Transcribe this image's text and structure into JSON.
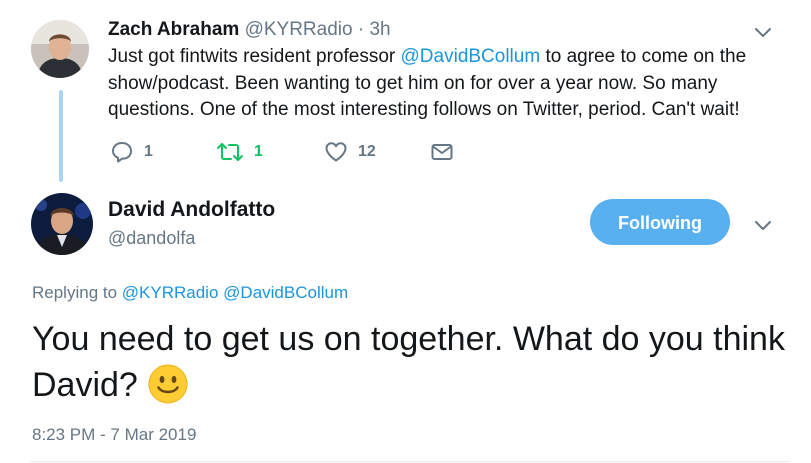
{
  "parent_tweet": {
    "display_name": "Zach Abraham",
    "handle": "@KYRRadio",
    "time": " · 3h",
    "text_before": "Just got fintwits resident professor ",
    "mention": "@DavidBCollum",
    "text_after": " to agree to come on the show/podcast. Been wanting to get him on for over a year now. So many questions. One of the most interesting follows on Twitter, period. Can't wait!",
    "actions": {
      "reply_count": "1",
      "retweet_count": "1",
      "like_count": "12"
    }
  },
  "main_tweet": {
    "display_name": "David Andolfatto",
    "handle": "@dandolfa",
    "follow_label": "Following",
    "replying_prefix": "Replying to ",
    "replying_mention_1": "@KYRRadio",
    "replying_mention_2": "@DavidBCollum",
    "text": "You need to get us on together. What do you think David?",
    "emoji": "slightly-smiling-face-emoji",
    "timestamp": "8:23 PM - 7 Mar 2019"
  },
  "colors": {
    "accent": "#1b95e0",
    "follow_button": "#58b0ee",
    "retweet_green": "#17bf63",
    "secondary_text": "#657786",
    "thread_line": "#a8d4f4"
  },
  "icons": [
    "reply-icon",
    "retweet-icon",
    "like-icon",
    "direct-message-icon",
    "chevron-down-icon"
  ]
}
